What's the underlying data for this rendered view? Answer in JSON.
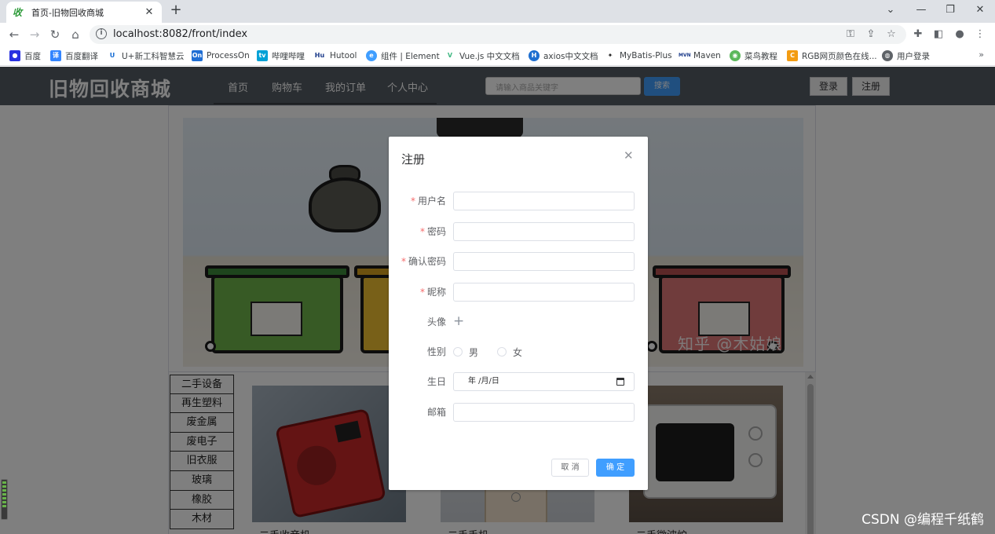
{
  "browser": {
    "tab_title": "首页-旧物回收商城",
    "tab_favicon": "收",
    "url": "localhost:8082/front/index",
    "window_controls": [
      "chevron-down-icon",
      "minimize-icon",
      "restore-icon",
      "close-icon"
    ],
    "bookmarks": [
      {
        "label": "百度",
        "icon": "baidu-icon",
        "color": "#2932e1"
      },
      {
        "label": "百度翻译",
        "icon": "translate-icon",
        "color": "#3385ff"
      },
      {
        "label": "U+新工科智慧云",
        "icon": "u-plus-icon",
        "color": "#1a6fd4"
      },
      {
        "label": "ProcessOn",
        "icon": "processon-icon",
        "color": "#1f6ed4"
      },
      {
        "label": "哔哩哔哩",
        "icon": "bilibili-icon",
        "color": "#00a1d6"
      },
      {
        "label": "Hutool",
        "icon": "hutool-icon",
        "color": "#1a3a8a"
      },
      {
        "label": "组件 | Element",
        "icon": "element-icon",
        "color": "#409eff"
      },
      {
        "label": "Vue.js 中文文档",
        "icon": "vue-icon",
        "color": "#35495e"
      },
      {
        "label": "axios中文文档",
        "icon": "axios-icon",
        "color": "#1e6fd0"
      },
      {
        "label": "MyBatis-Plus",
        "icon": "mybatis-icon",
        "color": "#222222"
      },
      {
        "label": "Maven",
        "icon": "maven-icon",
        "color": "#1a3a8a"
      },
      {
        "label": "菜鸟教程",
        "icon": "runoob-icon",
        "color": "#5cb85c"
      },
      {
        "label": "RGB网页颜色在线...",
        "icon": "rgb-icon",
        "color": "#f39c12"
      },
      {
        "label": "用户登录",
        "icon": "globe-icon",
        "color": "#5f6368"
      }
    ],
    "more": "»"
  },
  "site": {
    "logo": "旧物回收商城",
    "menu": [
      "首页",
      "购物车",
      "我的订单",
      "个人中心"
    ],
    "search_placeholder": "请输入商品关键字",
    "search_button": "搜索",
    "login_button": "登录",
    "register_button": "注册",
    "banner_watermark": "知乎 @木姑娘",
    "categories": [
      "二手设备",
      "再生塑料",
      "废金属",
      "废电子",
      "旧衣服",
      "玻璃",
      "橡胶",
      "木材"
    ],
    "products": [
      {
        "name": "二手收音机"
      },
      {
        "name": "二手手机"
      },
      {
        "name": "二手微波炉"
      }
    ],
    "csdn_watermark": "CSDN @编程千纸鹤"
  },
  "dialog": {
    "title": "注册",
    "close_icon": "close-icon",
    "fields": [
      {
        "label": "用户名",
        "required": true,
        "value": ""
      },
      {
        "label": "密码",
        "required": true,
        "value": ""
      },
      {
        "label": "确认密码",
        "required": true,
        "value": ""
      },
      {
        "label": "昵称",
        "required": true,
        "value": ""
      }
    ],
    "required_mark": "*",
    "avatar_label": "头像",
    "avatar_add": "+",
    "gender_label": "性别",
    "gender_options": [
      "男",
      "女"
    ],
    "birthday_label": "生日",
    "birthday_placeholder": "年 /月/日",
    "email_label": "邮箱",
    "email_value": "",
    "cancel_label": "取 消",
    "confirm_label": "确 定"
  },
  "colors": {
    "nav_bg": "#545c64",
    "primary": "#409eff",
    "required": "#f56c6c",
    "overlay": "rgba(0,0,0,0.5)"
  }
}
